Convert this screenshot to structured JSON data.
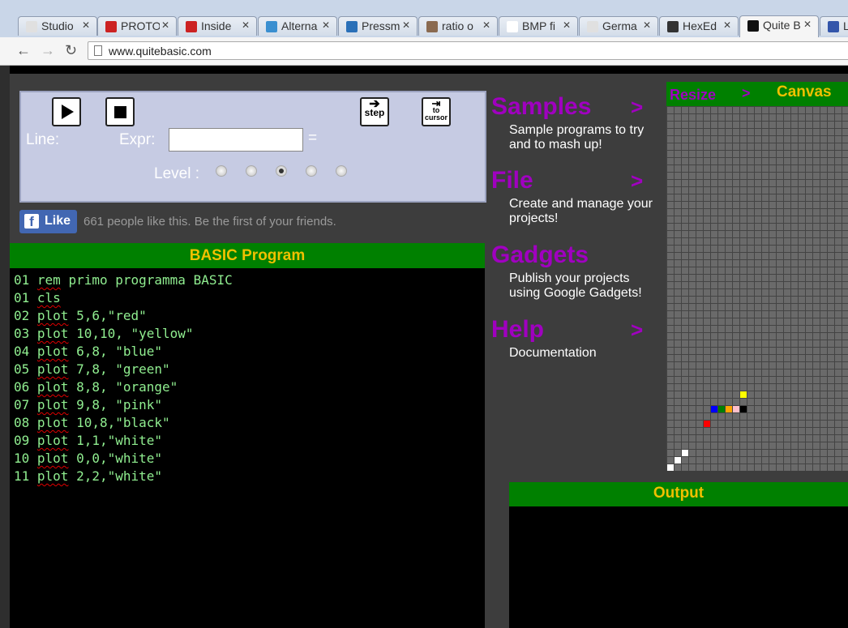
{
  "browser": {
    "tabs": [
      {
        "label": "Studio",
        "fav_color": "#e0e0e0"
      },
      {
        "label": "PROTO",
        "fav_color": "#cc2222"
      },
      {
        "label": "Inside",
        "fav_color": "#cc2222"
      },
      {
        "label": "Alterna",
        "fav_color": "#3a8fd0"
      },
      {
        "label": "Pressm",
        "fav_color": "#2a70b8"
      },
      {
        "label": "ratio o",
        "fav_color": "#8a6a50"
      },
      {
        "label": "BMP fi",
        "fav_color": "#ffffff"
      },
      {
        "label": "Germa",
        "fav_color": "#e0e0e0"
      },
      {
        "label": "HexEd",
        "fav_color": "#333333"
      },
      {
        "label": "Quite B",
        "fav_color": "#111111"
      },
      {
        "label": "L",
        "fav_color": "#3355aa"
      }
    ],
    "url": "www.quitebasic.com"
  },
  "debugger": {
    "line_label": "Line:",
    "expr_label": "Expr:",
    "equals": "=",
    "level_label": "Level :",
    "step_label": "step",
    "cursor_label_1": "to",
    "cursor_label_2": "cursor",
    "level_selected": 3,
    "level_count": 5
  },
  "like": {
    "button_label": "Like",
    "text": "661 people like this. Be the first of your friends."
  },
  "program": {
    "title": "BASIC Program",
    "lines": [
      {
        "num": "01",
        "kw": "rem",
        "rest": " primo programma BASIC"
      },
      {
        "num": "01",
        "kw": "cls",
        "rest": ""
      },
      {
        "num": "02",
        "kw": "plot",
        "rest": " 5,6,\"red\""
      },
      {
        "num": "03",
        "kw": "plot",
        "rest": " 10,10, \"yellow\""
      },
      {
        "num": "04",
        "kw": "plot",
        "rest": " 6,8, \"blue\""
      },
      {
        "num": "05",
        "kw": "plot",
        "rest": " 7,8, \"green\""
      },
      {
        "num": "06",
        "kw": "plot",
        "rest": " 8,8, \"orange\""
      },
      {
        "num": "07",
        "kw": "plot",
        "rest": " 9,8, \"pink\""
      },
      {
        "num": "08",
        "kw": "plot",
        "rest": " 10,8,\"black\""
      },
      {
        "num": "09",
        "kw": "plot",
        "rest": " 1,1,\"white\""
      },
      {
        "num": "10",
        "kw": "plot",
        "rest": " 0,0,\"white\""
      },
      {
        "num": "11",
        "kw": "plot",
        "rest": " 2,2,\"white\""
      }
    ]
  },
  "menu": [
    {
      "title": "Samples",
      "arrow": ">",
      "desc": "Sample programs to try and to mash up!"
    },
    {
      "title": "File",
      "arrow": ">",
      "desc": "Create and manage your projects!"
    },
    {
      "title": "Gadgets",
      "arrow": "",
      "desc": "Publish your projects using Google Gadgets!"
    },
    {
      "title": "Help",
      "arrow": ">",
      "desc": "Documentation"
    }
  ],
  "canvas": {
    "title": "Canvas",
    "resize_label": "Resize",
    "resize_arrow": ">",
    "pixels": [
      {
        "x": 5,
        "y": 6,
        "color": "#ff0000"
      },
      {
        "x": 10,
        "y": 10,
        "color": "#ffff00"
      },
      {
        "x": 6,
        "y": 8,
        "color": "#0000ff"
      },
      {
        "x": 7,
        "y": 8,
        "color": "#008000"
      },
      {
        "x": 8,
        "y": 8,
        "color": "#ffa500"
      },
      {
        "x": 9,
        "y": 8,
        "color": "#ffc0cb"
      },
      {
        "x": 10,
        "y": 8,
        "color": "#000000"
      },
      {
        "x": 1,
        "y": 1,
        "color": "#ffffff"
      },
      {
        "x": 0,
        "y": 0,
        "color": "#ffffff"
      },
      {
        "x": 2,
        "y": 2,
        "color": "#ffffff"
      }
    ]
  },
  "output": {
    "title": "Output"
  }
}
